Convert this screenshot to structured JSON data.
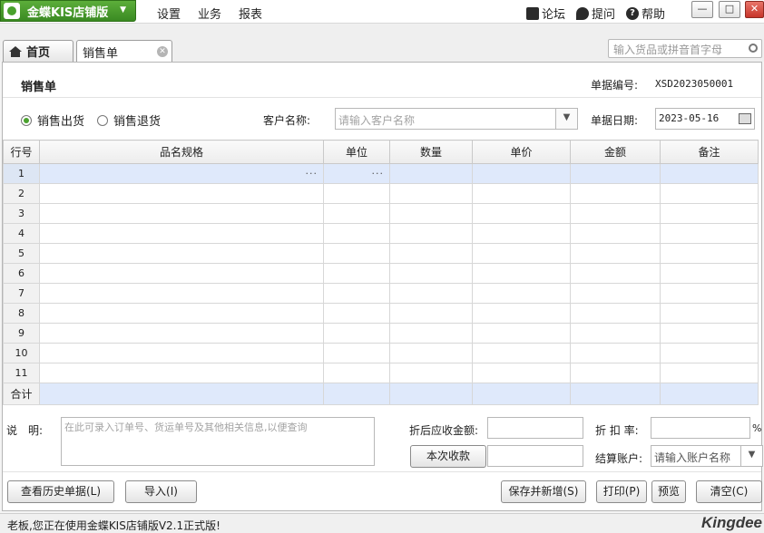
{
  "app": {
    "title": "金蝶KIS店铺版"
  },
  "menu": [
    "设置",
    "业务",
    "报表"
  ],
  "tools": {
    "forum": "论坛",
    "ask": "提问",
    "help": "帮助"
  },
  "tabs": {
    "home": "首页",
    "active": "销售单"
  },
  "search": {
    "placeholder": "输入货品或拼音首字母"
  },
  "form": {
    "title": "销售单",
    "bill_no_label": "单据编号:",
    "bill_no": "XSD2023050001",
    "radio_out": "销售出货",
    "radio_return": "销售退货",
    "selected_radio": "销售出货",
    "customer_label": "客户名称:",
    "customer_placeholder": "请输入客户名称",
    "date_label": "单据日期:",
    "date": "2023-05-16"
  },
  "grid": {
    "headers": [
      "行号",
      "品名规格",
      "单位",
      "数量",
      "单价",
      "金额",
      "备注"
    ],
    "rows": [
      "1",
      "2",
      "3",
      "4",
      "5",
      "6",
      "7",
      "8",
      "9",
      "10",
      "11"
    ],
    "total_label": "合计",
    "ellipsis": "···"
  },
  "bottom": {
    "note_label": "说　明:",
    "note_placeholder": "在此可录入订单号、货运单号及其他相关信息,以便查询",
    "amount_label": "折后应收金额:",
    "discount_label": "折 扣 率:",
    "percent": "%",
    "receive_button": "本次收款",
    "account_label": "结算账户:",
    "account_placeholder": "请输入账户名称"
  },
  "buttons": {
    "history": "查看历史单据(L)",
    "import": "导入(I)",
    "save_new": "保存并新增(S)",
    "print": "打印(P)",
    "preview": "预览",
    "clear": "清空(C)"
  },
  "status": {
    "text": "老板,您正在使用金蝶KIS店铺版V2.1正式版!",
    "brand": "Kingdee"
  },
  "colors": {
    "accent": "#4aa22e",
    "selected_row": "#dfe9fb"
  }
}
